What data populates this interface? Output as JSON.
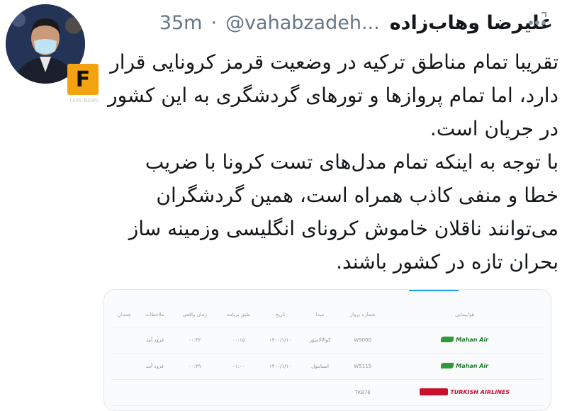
{
  "header": {
    "display_name": "علیرضا وهاب‌زاده",
    "handle": "@vahabzadeh...",
    "separator": "·",
    "time": "35m"
  },
  "avatar_badge": {
    "letter": "F",
    "watermark_text": "FARS NEWS"
  },
  "icons": {
    "more": "more-options-icon"
  },
  "tweet": {
    "paragraph_1": "تقریبا تمام مناطق ترکیه در وضعیت قرمز کرونایی قرار دارد، اما تمام پروازها و تورهای گردشگری به این کشور در جریان است.",
    "paragraph_2": "با توجه به اینکه تمام مدل‌های تست کرونا با ضریب خطا و منفی کاذب همراه است، همین گردشگران می‌توانند ناقلان خاموش کرونای انگلیسی وزمینه ساز بحران تازه در کشور باشند."
  },
  "flight_table": {
    "headers": [
      "هواپیمایی",
      "شماره پرواز",
      "مبدا",
      "تاریخ",
      "طبق برنامه",
      "زمان واقعی",
      "ملاحظات",
      "چمدان"
    ],
    "rows": [
      {
        "airline": "Mahan Air",
        "flight": "W5000",
        "origin": "کوالالامپور",
        "date": "۱۴۰۰/۱/۱۰",
        "scheduled": "۰۰:۱۵",
        "actual": "۰۰:۳۲",
        "remarks": "فرود آمد",
        "baggage": ""
      },
      {
        "airline": "Mahan Air",
        "flight": "W5115",
        "origin": "استانبول",
        "date": "۱۴۰۰/۱/۱۰",
        "scheduled": "۰۱:۰۰",
        "actual": "۰۰:۳۹",
        "remarks": "فرود آمد",
        "baggage": ""
      },
      {
        "airline": "TURKISH AIRLINES",
        "flight": "TK878",
        "origin": "",
        "date": "",
        "scheduled": "",
        "actual": "",
        "remarks": "",
        "baggage": ""
      }
    ]
  }
}
